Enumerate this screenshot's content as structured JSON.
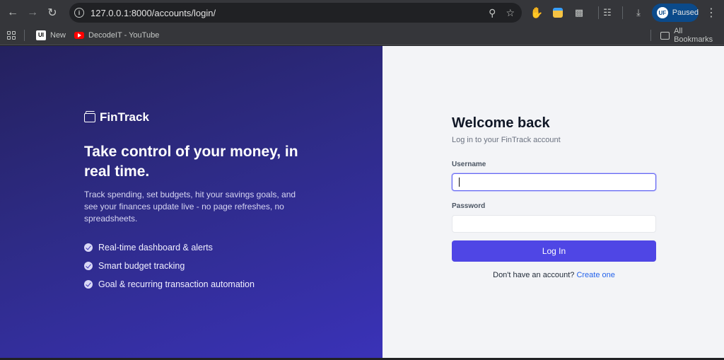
{
  "browser": {
    "url": "127.0.0.1:8000/accounts/login/",
    "profile_status": "Paused",
    "profile_initials": "UF",
    "icons": {
      "back": "arrow-left-icon",
      "forward": "arrow-right-icon",
      "reload": "reload-icon",
      "site_info": "info-icon",
      "zoom": "zoom-icon",
      "bookmark": "star-icon",
      "download": "download-icon",
      "menu": "kebab-menu-icon"
    }
  },
  "bookmarks_bar": {
    "items": [
      {
        "label": "New",
        "icon": "new-favicon"
      },
      {
        "label": "DecodeIT - YouTube",
        "icon": "youtube-icon"
      }
    ],
    "all_bookmarks": "All Bookmarks"
  },
  "hero": {
    "brand": "FinTrack",
    "headline": "Take control of your money, in real time.",
    "subtext": "Track spending, set budgets, hit your savings goals, and see your finances update live - no page refreshes, no spreadsheets.",
    "features": [
      "Real-time dashboard & alerts",
      "Smart budget tracking",
      "Goal & recurring transaction automation"
    ]
  },
  "login": {
    "title": "Welcome back",
    "subtitle": "Log in to your FinTrack account",
    "username_label": "Username",
    "username_value": "",
    "password_label": "Password",
    "password_value": "",
    "submit_label": "Log In",
    "signup_prompt": "Don't have an account?",
    "signup_link": "Create one"
  },
  "colors": {
    "primary": "#4f46e5",
    "link": "#2563eb",
    "hero_gradient_start": "#24215e",
    "hero_gradient_end": "#3a32b8"
  }
}
